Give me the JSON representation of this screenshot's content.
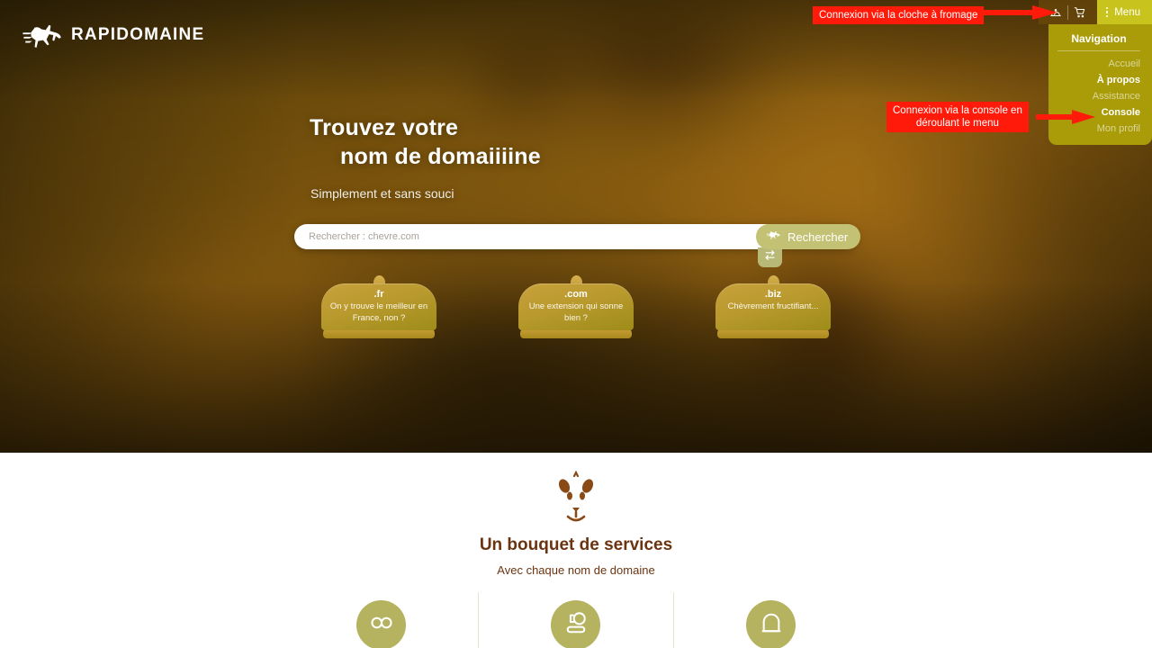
{
  "brand": {
    "name": "RAPIDOMAINE",
    "logo_icon": "goat-jumping-icon"
  },
  "topbar": {
    "cheese_bell_icon": "cheese-bell-icon",
    "cart_icon": "shopping-cart-icon",
    "menu_dots_icon": "vertical-dots-icon",
    "menu_label": "Menu"
  },
  "dropdown": {
    "title": "Navigation",
    "items": [
      {
        "label": "Accueil",
        "active": false
      },
      {
        "label": "À propos",
        "active": true
      },
      {
        "label": "Assistance",
        "active": false
      },
      {
        "label": "Console",
        "active": true
      },
      {
        "label": "Mon profil",
        "active": false
      }
    ]
  },
  "annotations": [
    {
      "text": "Connexion via la cloche à fromage",
      "color": "#ff1a0a"
    },
    {
      "text": "Connexion via la console en\ndéroulant le menu",
      "color": "#ff1a0a"
    }
  ],
  "hero": {
    "title_line1": "Trouvez votre",
    "title_line2": "nom de domaiiiine",
    "subtitle": "Simplement et sans souci"
  },
  "search": {
    "placeholder": "Rechercher : chevre.com",
    "value": "",
    "button_label": "Rechercher",
    "button_icon": "goat-jumping-icon",
    "swap_icon": "transfer-arrows-icon"
  },
  "domain_cards": [
    {
      "tld": ".fr",
      "tagline": "On y trouve le meilleur en France, non ?"
    },
    {
      "tld": ".com",
      "tagline": "Une extension qui sonne bien ?"
    },
    {
      "tld": ".biz",
      "tagline": "Chèvrement fructifiant..."
    }
  ],
  "services": {
    "icon": "goat-face-icon",
    "title": "Un bouquet de services",
    "subtitle": "Avec chaque nom de domaine",
    "items": [
      {
        "icon": "infinity-icon"
      },
      {
        "icon": "cheese-plate-icon"
      },
      {
        "icon": "cloche-dome-icon"
      }
    ]
  },
  "colors": {
    "menu_button": "#c9c41d",
    "dropdown_bg": "#a99c08",
    "annotation_red": "#ff1a0a",
    "search_button": "#c3c274",
    "service_circle": "#b5b35f",
    "services_text": "#6b3410",
    "card_gold": "#c9a13c"
  }
}
